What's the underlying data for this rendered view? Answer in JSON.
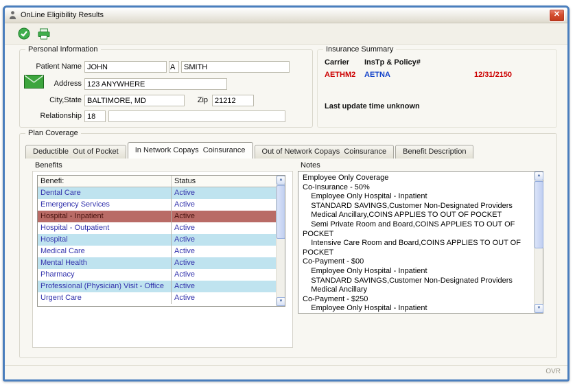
{
  "window": {
    "title": "OnLine Eligibility Results",
    "status_ovr": "OVR"
  },
  "icons": {
    "close": "✕",
    "scroll_up": "▲",
    "scroll_down": "▼"
  },
  "personal_information": {
    "title": "Personal Information",
    "labels": {
      "patient_name": "Patient Name",
      "address": "Address",
      "city_state": "City,State",
      "zip": "Zip",
      "relationship": "Relationship"
    },
    "values": {
      "first_name": "JOHN",
      "middle_initial": "A",
      "last_name": "SMITH",
      "address": "123 ANYWHERE",
      "city_state": "BALTIMORE, MD",
      "zip": "21212",
      "relationship_code": "18",
      "relationship_desc": ""
    }
  },
  "insurance_summary": {
    "title": "Insurance Summary",
    "carrier_header": "Carrier",
    "policy_header": "InsTp & Policy#",
    "carrier": "AETHM2",
    "ins_tp": "AETNA",
    "expiration_date": "12/31/2150",
    "last_update": "Last update time unknown",
    "colors": {
      "carrier": "#cc0000",
      "ins_tp": "#1141c9",
      "expiration_date": "#cc0000"
    }
  },
  "plan_coverage": {
    "title": "Plan Coverage",
    "tabs": [
      {
        "label": "Deductible  Out of Pocket",
        "active": false
      },
      {
        "label": "In Network Copays  Coinsurance",
        "active": true
      },
      {
        "label": "Out of Network Copays  Coinsurance",
        "active": false
      },
      {
        "label": "Benefit Description",
        "active": false
      }
    ],
    "benefits": {
      "label": "Benefits",
      "columns": [
        "Benefi:",
        "Status"
      ],
      "rows": [
        {
          "name": "Dental Care",
          "status": "Active",
          "selected": false
        },
        {
          "name": "Emergency Services",
          "status": "Active",
          "selected": false
        },
        {
          "name": "Hospital - Inpatient",
          "status": "Active",
          "selected": true
        },
        {
          "name": "Hospital - Outpatient",
          "status": "Active",
          "selected": false
        },
        {
          "name": "Hospital",
          "status": "Active",
          "selected": false
        },
        {
          "name": "Medical Care",
          "status": "Active",
          "selected": false
        },
        {
          "name": "Mental Health",
          "status": "Active",
          "selected": false
        },
        {
          "name": "Pharmacy",
          "status": "Active",
          "selected": false
        },
        {
          "name": "Professional (Physician) Visit - Office",
          "status": "Active",
          "selected": false
        },
        {
          "name": "Urgent Care",
          "status": "Active",
          "selected": false
        }
      ]
    },
    "notes": {
      "label": "Notes",
      "lines": [
        "Employee Only Coverage",
        "Co-Insurance - 50%",
        "    Employee Only Hospital - Inpatient",
        "    STANDARD SAVINGS,Customer Non-Designated Providers",
        "    Medical Ancillary,COINS APPLIES TO OUT OF POCKET",
        "    Semi Private Room and Board,COINS APPLIES TO OUT OF POCKET",
        "    Intensive Care Room and Board,COINS APPLIES TO OUT OF POCKET",
        "Co-Payment - $00",
        "    Employee Only Hospital - Inpatient",
        "    STANDARD SAVINGS,Customer Non-Designated Providers",
        "    Medical Ancillary",
        "Co-Payment - $250",
        "    Employee Only Hospital - Inpatient"
      ]
    },
    "colors": {
      "row_alt": "#bfe3ef",
      "row_selected": "#b96b66",
      "benefit_text": "#3434ad",
      "selected_text": "#4a1410"
    }
  }
}
